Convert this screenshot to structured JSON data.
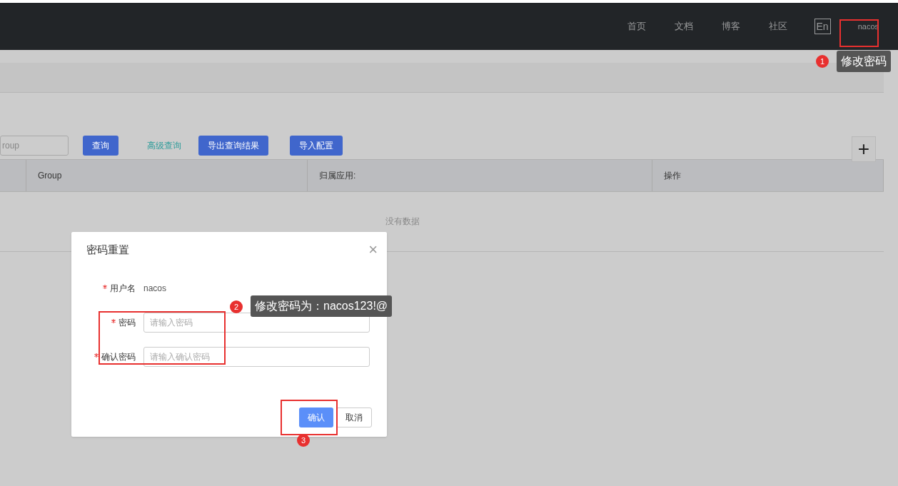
{
  "topbar": {
    "nav": [
      "首页",
      "文档",
      "博客",
      "社区"
    ],
    "language": "En",
    "user": "nacos"
  },
  "toolbar": {
    "search": {
      "placeholder": "roup"
    },
    "query_button": "查询",
    "advanced_link": "高级查询",
    "export_button": "导出查询结果",
    "import_button": "导入配置",
    "add_button": "+"
  },
  "table": {
    "columns": [
      "Group",
      "归属应用:",
      "操作"
    ],
    "empty_text": "没有数据"
  },
  "dialog": {
    "title": "密码重置",
    "close": "×",
    "fields": [
      {
        "kind": "text",
        "label": "用户名",
        "required": true,
        "value": "nacos"
      },
      {
        "kind": "input",
        "label": "密码",
        "required": true,
        "placeholder": "请输入密码"
      },
      {
        "kind": "input",
        "label": "确认密码",
        "required": true,
        "placeholder": "请输入确认密码"
      }
    ],
    "confirm_button": "确认",
    "cancel_button": "取消"
  },
  "annotations": [
    {
      "number": "1",
      "note": "修改密码"
    },
    {
      "number": "2",
      "note": "修改密码为：nacos123!@"
    },
    {
      "number": "3"
    }
  ]
}
